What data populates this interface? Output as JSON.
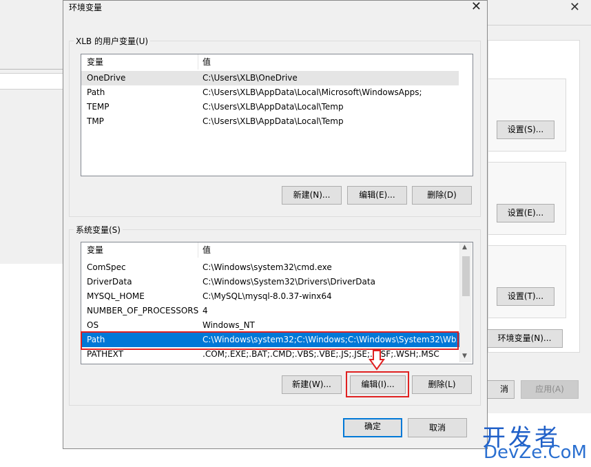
{
  "dialog": {
    "title": "环境变量",
    "user_group_label": "XLB 的用户变量(U)",
    "system_group_label": "系统变量(S)",
    "ok_label": "确定",
    "cancel_label": "取消",
    "close_glyph": "✕"
  },
  "user_vars": {
    "headers": [
      "变量",
      "值"
    ],
    "rows": [
      {
        "name": "OneDrive",
        "value": "C:\\Users\\XLB\\OneDrive"
      },
      {
        "name": "Path",
        "value": "C:\\Users\\XLB\\AppData\\Local\\Microsoft\\WindowsApps;"
      },
      {
        "name": "TEMP",
        "value": "C:\\Users\\XLB\\AppData\\Local\\Temp"
      },
      {
        "name": "TMP",
        "value": "C:\\Users\\XLB\\AppData\\Local\\Temp"
      }
    ],
    "new_label": "新建(N)...",
    "edit_label": "编辑(E)...",
    "delete_label": "删除(D)"
  },
  "system_vars": {
    "headers": [
      "变量",
      "值"
    ],
    "rows": [
      {
        "name": "ComSpec",
        "value": "C:\\Windows\\system32\\cmd.exe"
      },
      {
        "name": "DriverData",
        "value": "C:\\Windows\\System32\\Drivers\\DriverData"
      },
      {
        "name": "MYSQL_HOME",
        "value": "C:\\MySQL\\mysql-8.0.37-winx64"
      },
      {
        "name": "NUMBER_OF_PROCESSORS",
        "value": "4"
      },
      {
        "name": "OS",
        "value": "Windows_NT"
      },
      {
        "name": "Path",
        "value": "C:\\Windows\\system32;C:\\Windows;C:\\Windows\\System32\\Wb..."
      },
      {
        "name": "PATHEXT",
        "value": ".COM;.EXE;.BAT;.CMD;.VBS;.VBE;.JS;.JSE;.WSF;.WSH;.MSC"
      }
    ],
    "selected_index": 5,
    "new_label": "新建(W)...",
    "edit_label": "编辑(I)...",
    "delete_label": "删除(L)"
  },
  "background_window": {
    "settings1": "设置(S)...",
    "settings2": "设置(E)...",
    "settings3": "设置(T)...",
    "env_button": "环境变量(N)...",
    "cancel_partial": "消",
    "apply": "应用(A)",
    "close_glyph": "✕"
  },
  "watermark": {
    "line1": "开发者",
    "line2": "DevZe.CoM"
  },
  "colors": {
    "selection": "#0078d7",
    "highlight_box": "#e02020",
    "watermark": "#2060c8"
  }
}
